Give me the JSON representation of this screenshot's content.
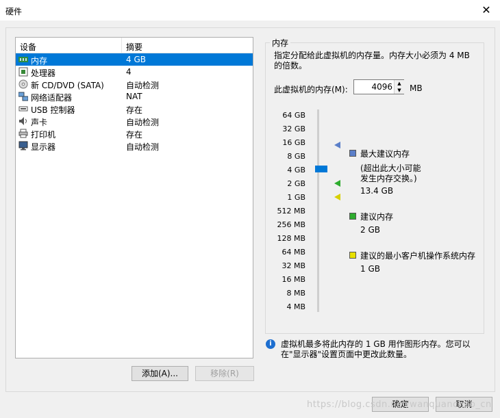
{
  "window": {
    "title": "硬件",
    "close_glyph": "✕"
  },
  "device_list": {
    "header_device": "设备",
    "header_summary": "摘要",
    "items": [
      {
        "name": "内存",
        "summary": "4 GB",
        "icon": "memory-icon",
        "selected": true
      },
      {
        "name": "处理器",
        "summary": "4",
        "icon": "processor-icon"
      },
      {
        "name": "新 CD/DVD (SATA)",
        "summary": "自动检测",
        "icon": "cd-dvd-icon"
      },
      {
        "name": "网络适配器",
        "summary": "NAT",
        "icon": "network-adapter-icon"
      },
      {
        "name": "USB 控制器",
        "summary": "存在",
        "icon": "usb-icon"
      },
      {
        "name": "声卡",
        "summary": "自动检测",
        "icon": "sound-card-icon"
      },
      {
        "name": "打印机",
        "summary": "存在",
        "icon": "printer-icon"
      },
      {
        "name": "显示器",
        "summary": "自动检测",
        "icon": "display-icon"
      }
    ]
  },
  "buttons": {
    "add": "添加(A)...",
    "remove": "移除(R)",
    "ok": "确定",
    "cancel": "取消"
  },
  "memory_panel": {
    "group_title": "内存",
    "description": "指定分配给此虚拟机的内存量。内存大小必须为 4 MB 的倍数。",
    "memory_label": "此虚拟机的内存(M):",
    "memory_value": "4096",
    "unit": "MB",
    "ticks": [
      "64 GB",
      "32 GB",
      "16 GB",
      "8 GB",
      "4 GB",
      "2 GB",
      "1 GB",
      "512 MB",
      "256 MB",
      "128 MB",
      "64 MB",
      "32 MB",
      "16 MB",
      "8 MB",
      "4 MB"
    ],
    "legend": {
      "max_label": "最大建议内存",
      "max_note_1": "(超出此大小可能",
      "max_note_2": "发生内存交换。)",
      "max_value": "13.4 GB",
      "rec_label": "建议内存",
      "rec_value": "2 GB",
      "min_label": "建议的最小客户机操作系统内存",
      "min_value": "1 GB"
    },
    "colors": {
      "max": "#5b7fc9",
      "recommended": "#2eac2e",
      "minimum": "#d8d000",
      "selection": "#0078d7"
    }
  },
  "info": {
    "icon": "info-icon",
    "text": "虚拟机最多将此内存的 1 GB 用作图形内存。您可以在\"显示器\"设置页面中更改此数量。"
  },
  "watermark": "https://blog.csdn.net/wanquanchao_cn"
}
